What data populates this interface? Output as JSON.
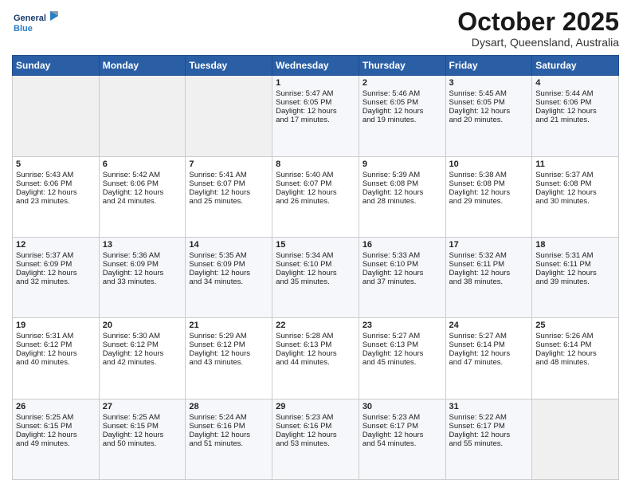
{
  "header": {
    "logo_line1": "General",
    "logo_line2": "Blue",
    "month_title": "October 2025",
    "location": "Dysart, Queensland, Australia"
  },
  "days_of_week": [
    "Sunday",
    "Monday",
    "Tuesday",
    "Wednesday",
    "Thursday",
    "Friday",
    "Saturday"
  ],
  "weeks": [
    [
      {
        "day": "",
        "info": ""
      },
      {
        "day": "",
        "info": ""
      },
      {
        "day": "",
        "info": ""
      },
      {
        "day": "1",
        "info": "Sunrise: 5:47 AM\nSunset: 6:05 PM\nDaylight: 12 hours\nand 17 minutes."
      },
      {
        "day": "2",
        "info": "Sunrise: 5:46 AM\nSunset: 6:05 PM\nDaylight: 12 hours\nand 19 minutes."
      },
      {
        "day": "3",
        "info": "Sunrise: 5:45 AM\nSunset: 6:05 PM\nDaylight: 12 hours\nand 20 minutes."
      },
      {
        "day": "4",
        "info": "Sunrise: 5:44 AM\nSunset: 6:06 PM\nDaylight: 12 hours\nand 21 minutes."
      }
    ],
    [
      {
        "day": "5",
        "info": "Sunrise: 5:43 AM\nSunset: 6:06 PM\nDaylight: 12 hours\nand 23 minutes."
      },
      {
        "day": "6",
        "info": "Sunrise: 5:42 AM\nSunset: 6:06 PM\nDaylight: 12 hours\nand 24 minutes."
      },
      {
        "day": "7",
        "info": "Sunrise: 5:41 AM\nSunset: 6:07 PM\nDaylight: 12 hours\nand 25 minutes."
      },
      {
        "day": "8",
        "info": "Sunrise: 5:40 AM\nSunset: 6:07 PM\nDaylight: 12 hours\nand 26 minutes."
      },
      {
        "day": "9",
        "info": "Sunrise: 5:39 AM\nSunset: 6:08 PM\nDaylight: 12 hours\nand 28 minutes."
      },
      {
        "day": "10",
        "info": "Sunrise: 5:38 AM\nSunset: 6:08 PM\nDaylight: 12 hours\nand 29 minutes."
      },
      {
        "day": "11",
        "info": "Sunrise: 5:37 AM\nSunset: 6:08 PM\nDaylight: 12 hours\nand 30 minutes."
      }
    ],
    [
      {
        "day": "12",
        "info": "Sunrise: 5:37 AM\nSunset: 6:09 PM\nDaylight: 12 hours\nand 32 minutes."
      },
      {
        "day": "13",
        "info": "Sunrise: 5:36 AM\nSunset: 6:09 PM\nDaylight: 12 hours\nand 33 minutes."
      },
      {
        "day": "14",
        "info": "Sunrise: 5:35 AM\nSunset: 6:09 PM\nDaylight: 12 hours\nand 34 minutes."
      },
      {
        "day": "15",
        "info": "Sunrise: 5:34 AM\nSunset: 6:10 PM\nDaylight: 12 hours\nand 35 minutes."
      },
      {
        "day": "16",
        "info": "Sunrise: 5:33 AM\nSunset: 6:10 PM\nDaylight: 12 hours\nand 37 minutes."
      },
      {
        "day": "17",
        "info": "Sunrise: 5:32 AM\nSunset: 6:11 PM\nDaylight: 12 hours\nand 38 minutes."
      },
      {
        "day": "18",
        "info": "Sunrise: 5:31 AM\nSunset: 6:11 PM\nDaylight: 12 hours\nand 39 minutes."
      }
    ],
    [
      {
        "day": "19",
        "info": "Sunrise: 5:31 AM\nSunset: 6:12 PM\nDaylight: 12 hours\nand 40 minutes."
      },
      {
        "day": "20",
        "info": "Sunrise: 5:30 AM\nSunset: 6:12 PM\nDaylight: 12 hours\nand 42 minutes."
      },
      {
        "day": "21",
        "info": "Sunrise: 5:29 AM\nSunset: 6:12 PM\nDaylight: 12 hours\nand 43 minutes."
      },
      {
        "day": "22",
        "info": "Sunrise: 5:28 AM\nSunset: 6:13 PM\nDaylight: 12 hours\nand 44 minutes."
      },
      {
        "day": "23",
        "info": "Sunrise: 5:27 AM\nSunset: 6:13 PM\nDaylight: 12 hours\nand 45 minutes."
      },
      {
        "day": "24",
        "info": "Sunrise: 5:27 AM\nSunset: 6:14 PM\nDaylight: 12 hours\nand 47 minutes."
      },
      {
        "day": "25",
        "info": "Sunrise: 5:26 AM\nSunset: 6:14 PM\nDaylight: 12 hours\nand 48 minutes."
      }
    ],
    [
      {
        "day": "26",
        "info": "Sunrise: 5:25 AM\nSunset: 6:15 PM\nDaylight: 12 hours\nand 49 minutes."
      },
      {
        "day": "27",
        "info": "Sunrise: 5:25 AM\nSunset: 6:15 PM\nDaylight: 12 hours\nand 50 minutes."
      },
      {
        "day": "28",
        "info": "Sunrise: 5:24 AM\nSunset: 6:16 PM\nDaylight: 12 hours\nand 51 minutes."
      },
      {
        "day": "29",
        "info": "Sunrise: 5:23 AM\nSunset: 6:16 PM\nDaylight: 12 hours\nand 53 minutes."
      },
      {
        "day": "30",
        "info": "Sunrise: 5:23 AM\nSunset: 6:17 PM\nDaylight: 12 hours\nand 54 minutes."
      },
      {
        "day": "31",
        "info": "Sunrise: 5:22 AM\nSunset: 6:17 PM\nDaylight: 12 hours\nand 55 minutes."
      },
      {
        "day": "",
        "info": ""
      }
    ]
  ]
}
